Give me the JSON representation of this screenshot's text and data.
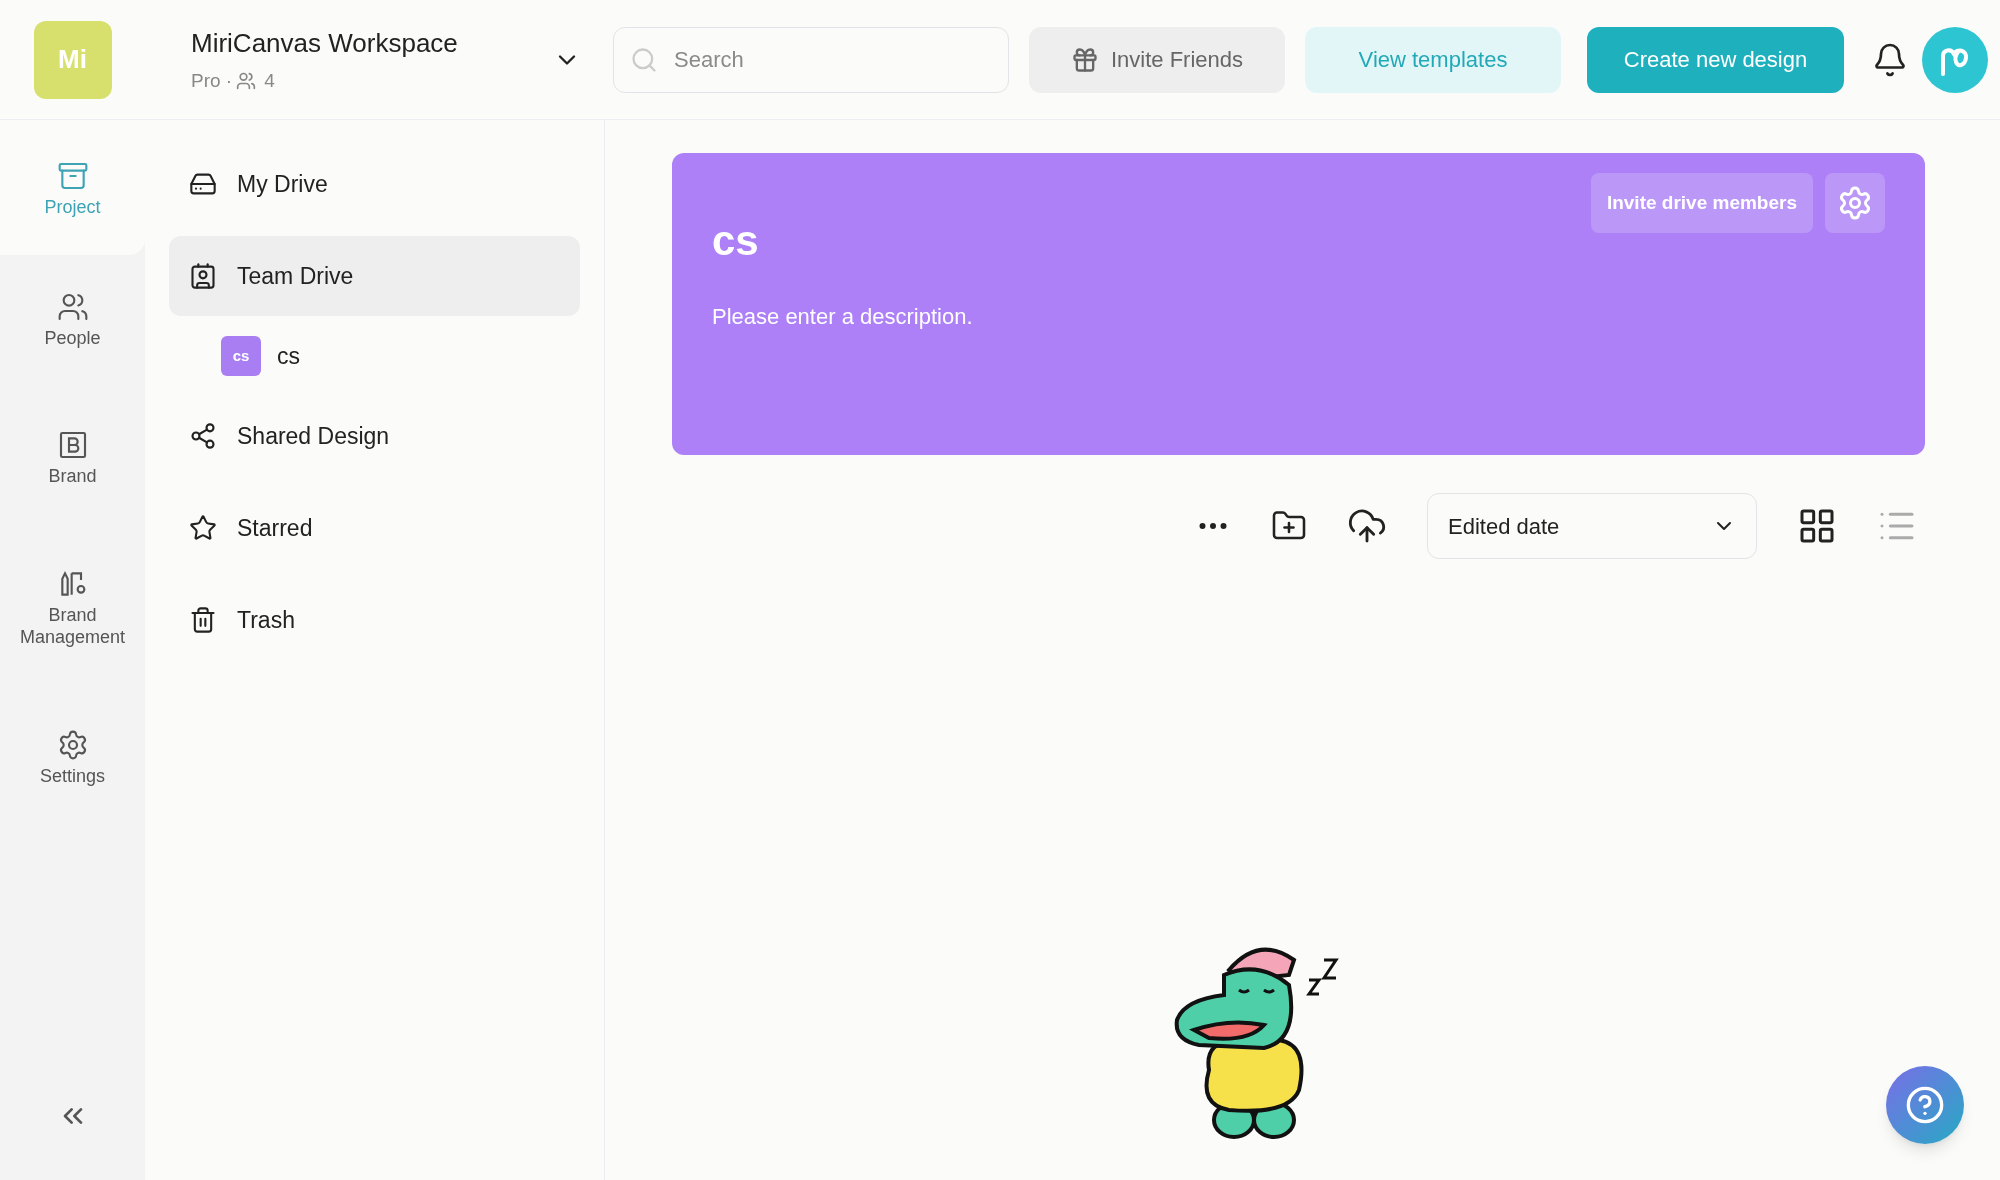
{
  "workspace": {
    "logo": "Mi",
    "name": "MiriCanvas Workspace",
    "plan": "Pro ·",
    "members": "4"
  },
  "search": {
    "placeholder": "Search"
  },
  "header_buttons": {
    "invite": "Invite Friends",
    "templates": "View templates",
    "create": "Create new design"
  },
  "rail": [
    {
      "kind": "project",
      "label": "Project",
      "selected": true
    },
    {
      "kind": "people",
      "label": "People",
      "selected": false
    },
    {
      "kind": "brand",
      "label": "Brand",
      "selected": false
    },
    {
      "kind": "brand-management",
      "label": "Brand Management",
      "selected": false
    },
    {
      "kind": "settings",
      "label": "Settings",
      "selected": false
    }
  ],
  "nav": [
    {
      "kind": "drive",
      "label": "My Drive",
      "selected": false
    },
    {
      "kind": "team",
      "label": "Team Drive",
      "selected": true,
      "children": [
        {
          "badge": "cs",
          "label": "cs"
        }
      ]
    },
    {
      "kind": "share",
      "label": "Shared Design",
      "selected": false
    },
    {
      "kind": "star",
      "label": "Starred",
      "selected": false
    },
    {
      "kind": "trash",
      "label": "Trash",
      "selected": false
    }
  ],
  "banner": {
    "title": "cs",
    "description": "Please enter a description.",
    "invite": "Invite drive members"
  },
  "toolbar": {
    "sort": "Edited date",
    "views": [
      {
        "kind": "grid",
        "selected": true
      },
      {
        "kind": "list",
        "selected": false
      }
    ]
  }
}
